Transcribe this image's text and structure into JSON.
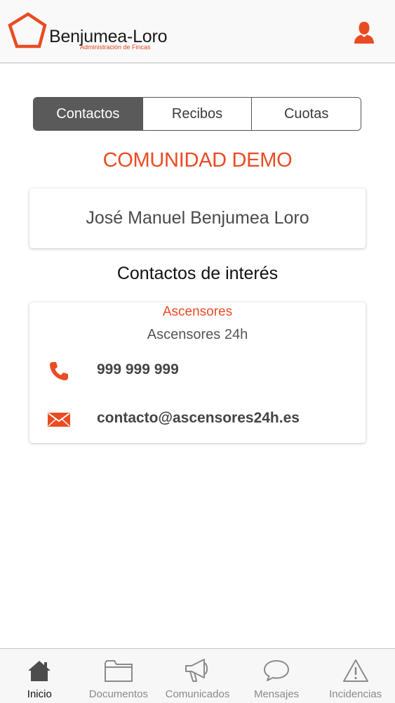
{
  "header": {
    "brand_name": "Benjumea-Loro",
    "brand_subtitle": "Administración de Fincas",
    "user_icon": "user-icon",
    "accent_color": "#ea4b22"
  },
  "tabs": [
    {
      "label": "Contactos",
      "active": true
    },
    {
      "label": "Recibos",
      "active": false
    },
    {
      "label": "Cuotas",
      "active": false
    }
  ],
  "community_name": "COMUNIDAD DEMO",
  "owner_name": "José Manuel Benjumea Loro",
  "contacts_section_title": "Contactos de interés",
  "contact": {
    "category": "Ascensores",
    "name": "Ascensores 24h",
    "phone": "999 999 999",
    "email": "contacto@ascensores24h.es"
  },
  "bottom_nav": [
    {
      "label": "Inicio",
      "icon": "home-icon",
      "active": true
    },
    {
      "label": "Documentos",
      "icon": "folder-icon",
      "active": false
    },
    {
      "label": "Comunicados",
      "icon": "megaphone-icon",
      "active": false
    },
    {
      "label": "Mensajes",
      "icon": "chat-bubble-icon",
      "active": false
    },
    {
      "label": "Incidencias",
      "icon": "warning-icon",
      "active": false
    }
  ]
}
